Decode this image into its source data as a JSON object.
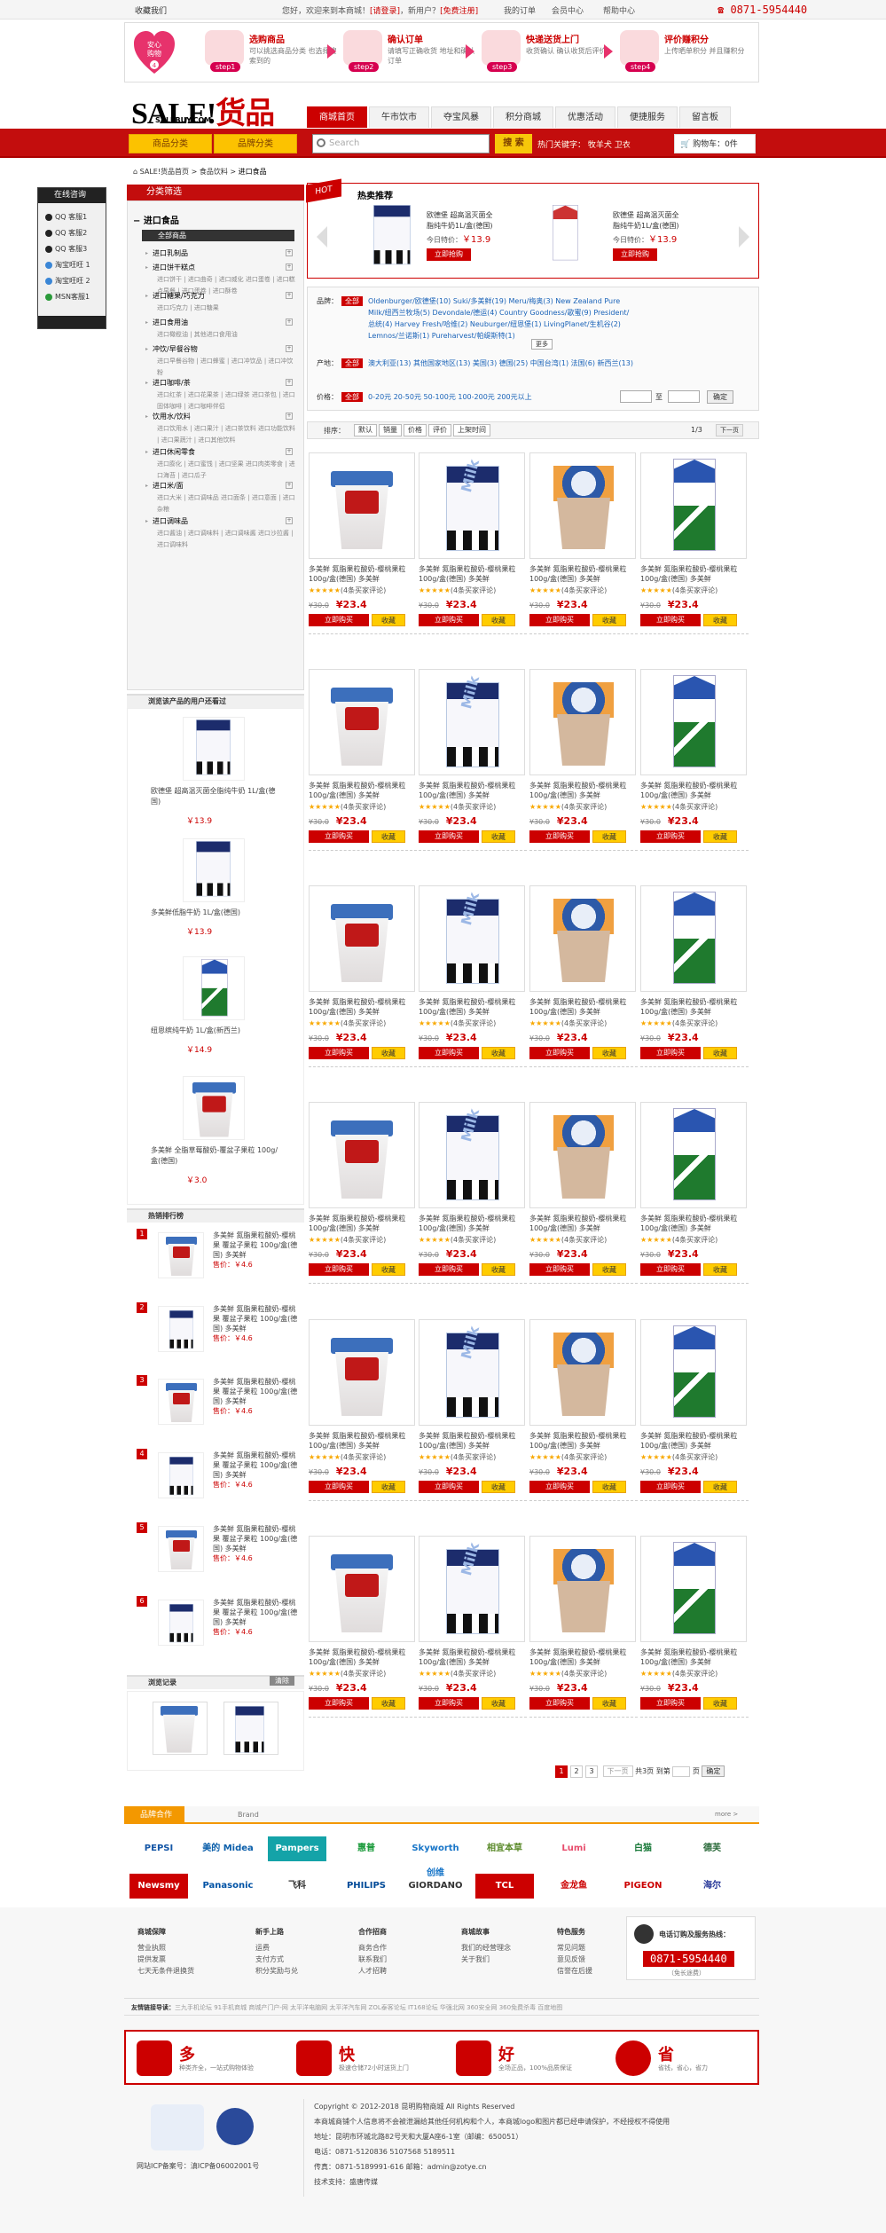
{
  "topbar": {
    "fav": "收藏我们",
    "welcome": "您好，欢迎来到本商城！",
    "login": "[请登录]",
    "newuser": "，新用户？",
    "reg": "[免费注册]",
    "myorder": "我的订单",
    "member": "会员中心",
    "help": "帮助中心",
    "phone": "0871-5954440"
  },
  "steps": {
    "heart": "安心购物",
    "items": [
      {
        "t": "选购商品",
        "d": "可以挑选商品分类 也选择搜索到的",
        "n": "step1"
      },
      {
        "t": "确认订单",
        "d": "请填写正确收货 地址和确认订单",
        "n": "step2"
      },
      {
        "t": "快递送货上门",
        "d": "收货确认 确认收货后评价",
        "n": "step3"
      },
      {
        "t": "评价赚积分",
        "d": "上传晒单积分 并且赚积分",
        "n": "step4"
      }
    ]
  },
  "logo": {
    "main": "SALE!",
    "cn": "货品",
    "sub": "SALEBUY.COM"
  },
  "nav": [
    "商城首页",
    "午市饮市",
    "夺宝风暴",
    "积分商城",
    "优惠活动",
    "便捷服务",
    "留言板"
  ],
  "catbtns": [
    "商品分类",
    "品牌分类"
  ],
  "search": {
    "placeholder": "Search",
    "button": "搜 索"
  },
  "hot": "热门关键字：  牧羊犬  卫衣",
  "cart": "购物车：0件",
  "crumb": [
    "SALE!货品首页",
    "食品饮料",
    "进口食品"
  ],
  "cs": {
    "title": "在线咨询",
    "items": [
      "QQ 客服1",
      "QQ 客服2",
      "QQ 客服3",
      "淘宝旺旺 1",
      "淘宝旺旺 2",
      "MSN客服1"
    ]
  },
  "left": {
    "title": "分类筛选",
    "root": "进口食品",
    "sel": "全部商品",
    "cats": [
      {
        "c": "进口乳制品",
        "s": ""
      },
      {
        "c": "进口饼干糕点",
        "s": "进口饼干 | 进口曲奇 | 进口威化 进口蛋卷 | 进口糕点早餐 | 进口蛋卷 | 进口酥卷"
      },
      {
        "c": "进口糖果/巧克力",
        "s": "进口巧克力 | 进口糖果"
      },
      {
        "c": "进口食用油",
        "s": "进口橄榄油 | 其他进口食用油"
      },
      {
        "c": "冲饮/早餐谷物",
        "s": "进口早餐谷物 | 进口蜂蜜 | 进口冲饮品 | 进口冲饮粉"
      },
      {
        "c": "进口咖啡/茶",
        "s": "进口红茶 | 进口花果茶 | 进口绿茶 进口茶包 | 进口固体咖啡 | 进口咖啡伴侣"
      },
      {
        "c": "饮用水/饮料",
        "s": "进口饮用水 | 进口果汁 | 进口茶饮料 进口功能饮料 | 进口果蔬汁 | 进口其他饮料"
      },
      {
        "c": "进口休闲零食",
        "s": "进口膨化 | 进口蜜饯 | 进口坚果 进口肉类零食 | 进口海苔 | 进口瓜子"
      },
      {
        "c": "进口米/面",
        "s": "进口大米 | 进口调味品 进口面条 | 进口意面 | 进口杂粮"
      },
      {
        "c": "进口调味品",
        "s": "进口酱油 | 进口调味料 | 进口调味酱 进口沙拉酱 | 进口调味料"
      }
    ]
  },
  "alsoTitle": "浏览该产品的用户还看过",
  "also": [
    {
      "t": "欧德堡 超高温灭菌全脂纯牛奶 1L/盒(德国)",
      "p": "￥13.9"
    },
    {
      "t": "多美鲜低脂牛奶 1L/盒(德国)",
      "p": "￥13.9"
    },
    {
      "t": "纽恩缤纯牛奶 1L/盒(新西兰)",
      "p": "￥14.9"
    },
    {
      "t": "多美鲜 全脂草莓酸奶-覆盆子果粒 100g/盒(德国)",
      "p": "￥3.0"
    }
  ],
  "rankTitle": "热销排行榜",
  "rank": [
    {
      "n": "1",
      "t": "多美鲜 氮脂果粒酸奶-樱桃果 覆盆子果粒 100g/盒(德国) 多美鲜",
      "p": "售价：￥4.6"
    },
    {
      "n": "2",
      "t": "多美鲜 氮脂果粒酸奶-樱桃果 覆盆子果粒 100g/盒(德国) 多美鲜",
      "p": "售价：￥4.6"
    },
    {
      "n": "3",
      "t": "多美鲜 氮脂果粒酸奶-樱桃果 覆盆子果粒 100g/盒(德国) 多美鲜",
      "p": "售价：￥4.6"
    },
    {
      "n": "4",
      "t": "多美鲜 氮脂果粒酸奶-樱桃果 覆盆子果粒 100g/盒(德国) 多美鲜",
      "p": "售价：￥4.6"
    },
    {
      "n": "5",
      "t": "多美鲜 氮脂果粒酸奶-樱桃果 覆盆子果粒 100g/盒(德国) 多美鲜",
      "p": "售价：￥4.6"
    },
    {
      "n": "6",
      "t": "多美鲜 氮脂果粒酸奶-樱桃果 覆盆子果粒 100g/盒(德国) 多美鲜",
      "p": "售价：￥4.6"
    }
  ],
  "history": {
    "title": "浏览记录",
    "clear": "清除"
  },
  "rec": {
    "hot": "HOT",
    "title": "热卖推荐",
    "items": [
      {
        "t": "欧德堡 超高温灭菌全脂纯牛奶1L/盒(德国)",
        "p": "今日特价：",
        "v": "￥13.9",
        "b": "立即抢购"
      },
      {
        "t": "欧德堡 超高温灭菌全脂纯牛奶1L/盒(德国)",
        "p": "今日特价：",
        "v": "￥13.9",
        "b": "立即抢购"
      }
    ]
  },
  "filters": {
    "brandLabel": "品牌：",
    "all": "全部",
    "brands": "Oldenburger/欧德堡(10)   Suki/多美鲜(19)   Meru/梅奥(3)   New Zealand Pure Milk/纽西兰牧场(5)   Devondale/德运(4)   Country Goodness/歌蜜(9)   President/总统(4)   Harvey Fresh/哈维(2)   Neuburger/纽恩堡(1)   LivingPlanet/生机谷(2)   Lemnos/兰诺斯(1)   Pureharvest/帕缇斯特(1)",
    "more": "更多",
    "originLabel": "产地：",
    "origins": "澳大利亚(13)   其他国家地区(13)   美国(3)   德国(25)   中国台湾(1)   法国(6)   新西兰(13)",
    "priceLabel": "价格：",
    "prices": "0-20元   20-50元   50-100元   100-200元   200元以上",
    "to": "至",
    "ok": "确定"
  },
  "sort": {
    "label": "排序：",
    "opts": [
      "默认",
      "销量",
      "价格",
      "评价",
      "上架时间"
    ],
    "page": "1/3",
    "next": "下一页"
  },
  "products": {
    "title": "多美鲜 氮脂果粒酸奶-樱桃果粒100g/盒(德国) 多美鲜",
    "stars": "★★★★★",
    "reviews": "(4条买家评论)",
    "old": "¥30.0",
    "price": "¥23.4",
    "buy": "立即购买",
    "fav": "收藏"
  },
  "pager": {
    "pages": [
      "1",
      "2",
      "3"
    ],
    "next": "下一页",
    "total": "共3页",
    "goto": "到第",
    "page": "页",
    "ok": "确定"
  },
  "brand": {
    "title": "品牌合作",
    "sub": "Brand",
    "more": "more >",
    "logos": [
      "PEPSI",
      "美的 Midea",
      "Pampers",
      "惠普",
      "Skyworth 创维",
      "相宜本草",
      "Lumi",
      "白猫",
      "德芙",
      "Newsmy",
      "Panasonic",
      "飞科",
      "PHILIPS",
      "GIORDANO",
      "TCL",
      "金龙鱼",
      "PIGEON",
      "海尔"
    ]
  },
  "footer": {
    "cols": [
      {
        "h": "商城保障",
        "l": [
          "营业执照",
          "提供发票",
          "七天无条件退换货"
        ]
      },
      {
        "h": "新手上路",
        "l": [
          "运费",
          "支付方式",
          "积分奖励与兑"
        ]
      },
      {
        "h": "合作招商",
        "l": [
          "商务合作",
          "联系我们",
          "人才招聘"
        ]
      },
      {
        "h": "商城故事",
        "l": [
          "我们的经营理念",
          "关于我们"
        ]
      },
      {
        "h": "特色服务",
        "l": [
          "常见问题",
          "意见反馈",
          "信誉在后援"
        ]
      }
    ],
    "phoneTitle": "电话订购及服务热线：",
    "phone": "0871-5954440",
    "phoneNote": "（免长途费）"
  },
  "links": {
    "label": "友情链接导读：",
    "text": "三九手机论坛  91手机商城  商城产门户-网  太平洋电脑网  太平洋汽车网  ZOL泰客论坛  IT168论坛  华强北网  360安全网  360免费杀毒  百度地图"
  },
  "feat": [
    {
      "t": "多",
      "d": "种类齐全，一站式购物体验"
    },
    {
      "t": "快",
      "d": "极速仓储72小时送货上门"
    },
    {
      "t": "好",
      "d": "全场正品，100%品质保证"
    },
    {
      "t": "省",
      "d": "省钱，省心，省力"
    }
  ],
  "copy": [
    "Copyright © 2012-2018  昆明购物商城  All Rights Reserved",
    "本商城商铺个人信息将不会被泄漏给其他任何机构和个人，本商城logo和图片都已经申请保护，不经授权不得使用",
    "地址：昆明市环城北路82号天和大厦A座6-1室（邮编：650051）",
    "电话：0871-5120836  5107568  5189511",
    "传真：0871-5189991-616  邮箱：admin@zotye.cn",
    "技术支持：盛唐传媒"
  ],
  "icp": "网站ICP备案号：滇ICP备06002001号"
}
